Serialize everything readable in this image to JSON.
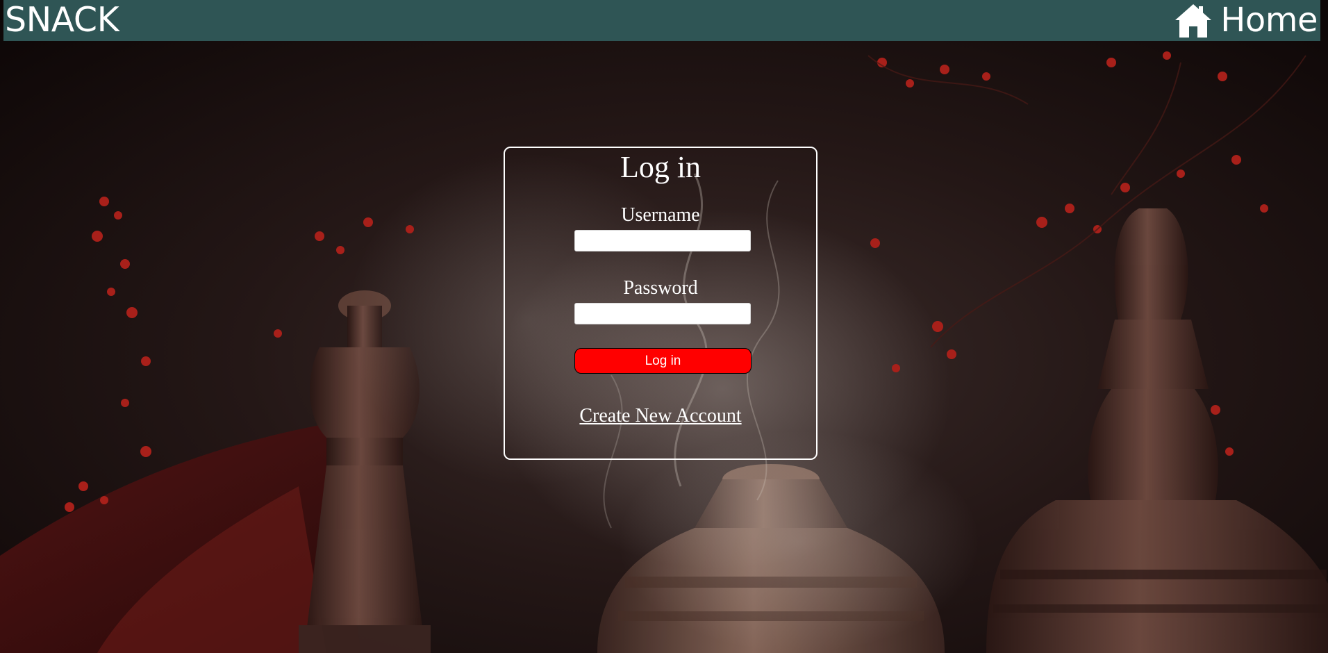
{
  "header": {
    "brand": "SNACK",
    "home_label": "Home",
    "home_icon": "home-icon",
    "background_color": "#2f5555"
  },
  "login": {
    "title": "Log in",
    "username_label": "Username",
    "username_value": "",
    "password_label": "Password",
    "password_value": "",
    "submit_label": "Log in",
    "create_account_label": "Create New Account"
  },
  "colors": {
    "panel_border": "#ffffff",
    "button_background": "#ff0000",
    "text": "#ffffff"
  }
}
